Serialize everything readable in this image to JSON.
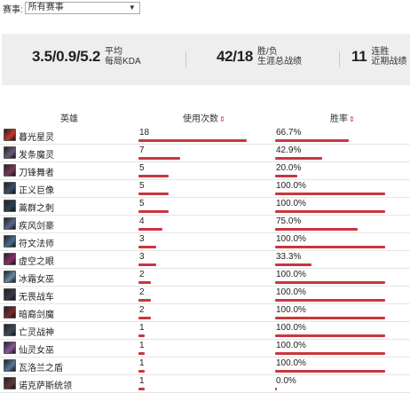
{
  "filter": {
    "label": "赛事:",
    "selected": "所有赛事"
  },
  "stats": {
    "kda_value": "3.5/0.9/5.2",
    "kda_label_line1": "平均",
    "kda_label_line2": "每局KDA",
    "record_value": "42/18",
    "record_label_line1": "胜/负",
    "record_label_line2": "生涯总战绩",
    "streak_value": "11",
    "streak_label_line1": "连胜",
    "streak_label_line2": "近期战绩"
  },
  "table": {
    "headers": {
      "hero": "英雄",
      "uses": "使用次数",
      "rate": "胜率",
      "sort_glyph": "⇕"
    },
    "rows": [
      {
        "name": "暮光星灵",
        "uses": 18,
        "rate": "66.7%",
        "rate_value": 66.7,
        "color": "#c0392b"
      },
      {
        "name": "发条魔灵",
        "uses": 7,
        "rate": "42.9%",
        "rate_value": 42.9,
        "color": "#6b5a7a"
      },
      {
        "name": "刀锋舞者",
        "uses": 5,
        "rate": "20.0%",
        "rate_value": 20.0,
        "color": "#7a3b5a"
      },
      {
        "name": "正义巨像",
        "uses": 5,
        "rate": "100.0%",
        "rate_value": 100.0,
        "color": "#3b4f6b"
      },
      {
        "name": "蒿群之刺",
        "uses": 5,
        "rate": "100.0%",
        "rate_value": 100.0,
        "color": "#2e3f52"
      },
      {
        "name": "疾风剑豪",
        "uses": 4,
        "rate": "75.0%",
        "rate_value": 75.0,
        "color": "#5a6a8a"
      },
      {
        "name": "符文法师",
        "uses": 3,
        "rate": "100.0%",
        "rate_value": 100.0,
        "color": "#4a6f8f"
      },
      {
        "name": "虚空之眼",
        "uses": 3,
        "rate": "33.3%",
        "rate_value": 33.3,
        "color": "#8a2f6a"
      },
      {
        "name": "冰霜女巫",
        "uses": 2,
        "rate": "100.0%",
        "rate_value": 100.0,
        "color": "#6b8aa8"
      },
      {
        "name": "无畏战车",
        "uses": 2,
        "rate": "100.0%",
        "rate_value": 100.0,
        "color": "#3a3a4a"
      },
      {
        "name": "暗裔剑魔",
        "uses": 2,
        "rate": "100.0%",
        "rate_value": 100.0,
        "color": "#7a2a2a"
      },
      {
        "name": "亡灵战神",
        "uses": 1,
        "rate": "100.0%",
        "rate_value": 100.0,
        "color": "#3f4a5a"
      },
      {
        "name": "仙灵女巫",
        "uses": 1,
        "rate": "100.0%",
        "rate_value": 100.0,
        "color": "#8a5a9a"
      },
      {
        "name": "瓦洛兰之盾",
        "uses": 1,
        "rate": "100.0%",
        "rate_value": 100.0,
        "color": "#5a7a9a"
      },
      {
        "name": "诺克萨斯统领",
        "uses": 1,
        "rate": "0.0%",
        "rate_value": 0.0,
        "color": "#5a3a3a"
      }
    ],
    "max_uses": 18
  }
}
